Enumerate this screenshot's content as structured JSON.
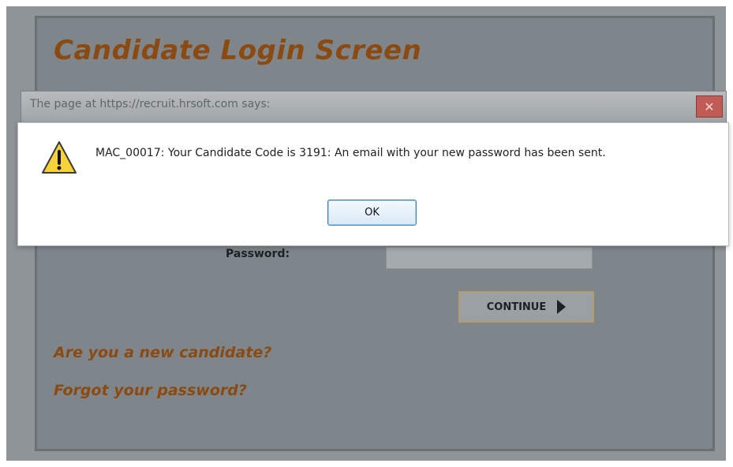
{
  "login_page": {
    "title": "Candidate Login Screen",
    "password_label": "Password:",
    "password_value": "",
    "continue_label": "CONTINUE",
    "new_candidate_link": "Are you a new candidate?",
    "forgot_password_link": "Forgot your password?"
  },
  "dialog": {
    "title": "The page at https://recruit.hrsoft.com says:",
    "close_glyph": "✕",
    "message": "MAC_00017:  Your Candidate Code is 3191: An email with your new password has been sent.",
    "ok_label": "OK",
    "icon": "warning-icon"
  }
}
